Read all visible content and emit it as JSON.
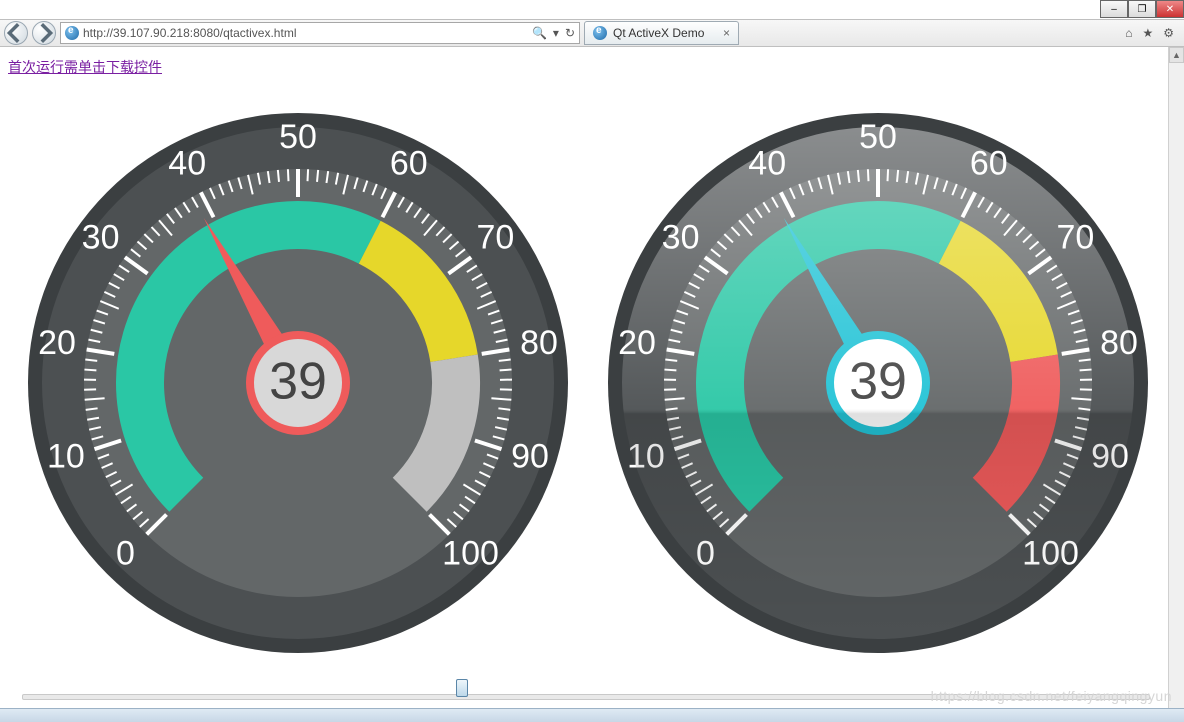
{
  "window": {
    "minimize": "–",
    "maximize": "❐",
    "close": "✕"
  },
  "browser": {
    "url": "http://39.107.90.218:8080/qtactivex.html",
    "url_host": "39.107.90.218",
    "search_icon": "🔍",
    "dropdown_icon": "▾",
    "refresh_icon": "↻",
    "tab_title": "Qt ActiveX Demo",
    "home_icon": "⌂",
    "star_icon": "★",
    "gear_icon": "⚙"
  },
  "page": {
    "download_link_text": "首次运行需单击下载控件",
    "watermark": "https://blog.csdn.net/feiyangqingyun"
  },
  "slider": {
    "value": 39,
    "min": 0,
    "max": 100
  },
  "chart_data": [
    {
      "type": "gauge",
      "title": "",
      "min": 0,
      "max": 100,
      "value": 39,
      "tick_labels": [
        0,
        10,
        20,
        30,
        40,
        50,
        60,
        70,
        80,
        90,
        100
      ],
      "color_bands": [
        {
          "from": 0,
          "to": 60,
          "color": "#2ac7a5"
        },
        {
          "from": 60,
          "to": 80,
          "color": "#e6d72a"
        },
        {
          "from": 80,
          "to": 100,
          "color": "#bfbfbf"
        }
      ],
      "needle_color": "#ef5b5b",
      "hub_ring_color": "#ef5b5b",
      "hub_fill": "#d8d8d8",
      "value_text_color": "#444444"
    },
    {
      "type": "gauge",
      "title": "",
      "min": 0,
      "max": 100,
      "value": 39,
      "tick_labels": [
        0,
        10,
        20,
        30,
        40,
        50,
        60,
        70,
        80,
        90,
        100
      ],
      "color_bands": [
        {
          "from": 0,
          "to": 60,
          "color": "#2ac7a5"
        },
        {
          "from": 60,
          "to": 80,
          "color": "#e6d72a"
        },
        {
          "from": 80,
          "to": 100,
          "color": "#ef5b5b"
        }
      ],
      "needle_color": "#22c3d6",
      "hub_ring_color": "#22c3d6",
      "hub_fill": "#ffffff",
      "value_text_color": "#444444",
      "glossy": true
    }
  ]
}
